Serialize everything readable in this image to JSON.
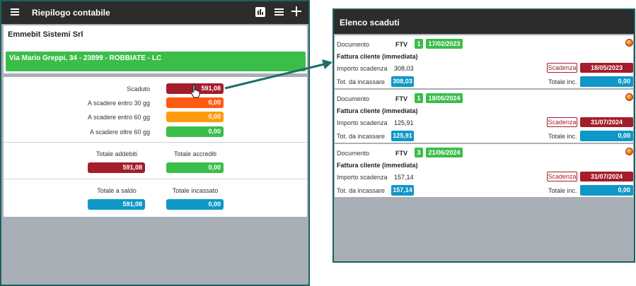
{
  "app": {
    "title": "Riepilogo contabile",
    "company_name": "Emmebit Sistemi Srl",
    "address": "Via Mario Greppi, 34 - 23899 - ROBBIATE - LC"
  },
  "summary": {
    "rows": [
      {
        "label": "Scaduto",
        "value": "591,08",
        "color": "#a51d2a"
      },
      {
        "label": "A scadere entro 30 gg",
        "value": "0,00",
        "color": "#ff5a12"
      },
      {
        "label": "A scadere entro 60 gg",
        "value": "0,00",
        "color": "#ff9a0f"
      },
      {
        "label": "A scadere oltre 60 gg",
        "value": "0,00",
        "color": "#3bbd4a"
      }
    ],
    "totale_addebiti_label": "Totale addebiti",
    "totale_addebiti_value": "591,08",
    "totale_accrediti_label": "Totale accrediti",
    "totale_accrediti_value": "0,00",
    "totale_saldo_label": "Totale a saldo",
    "totale_saldo_value": "591,08",
    "totale_incassato_label": "Totale incassato",
    "totale_incassato_value": "0,00"
  },
  "overdue_list": {
    "title": "Elenco scaduti",
    "labels": {
      "documento": "Documento",
      "importo": "Importo scadenza",
      "tot_incassare": "Tot. da incassare",
      "scadenza": "Scadenza",
      "totale_inc": "Totale inc."
    },
    "entries": [
      {
        "doc_type": "FTV",
        "number": "1",
        "date": "17/02/2023",
        "description": "Fattura cliente (immediata)",
        "amount": "308,03",
        "due_date": "18/05/2023",
        "to_collect": "308,03",
        "total_collected": "0,00"
      },
      {
        "doc_type": "FTV",
        "number": "1",
        "date": "18/06/2024",
        "description": "Fattura cliente (immediata)",
        "amount": "125,91",
        "due_date": "31/07/2024",
        "to_collect": "125,91",
        "total_collected": "0,00"
      },
      {
        "doc_type": "FTV",
        "number": "3",
        "date": "21/06/2024",
        "description": "Fattura cliente (immediata)",
        "amount": "157,14",
        "due_date": "31/07/2024",
        "to_collect": "157,14",
        "total_collected": "0,00"
      }
    ]
  },
  "colors": {
    "header": "#2c2c2c",
    "accent_green": "#3bbd4a",
    "danger_red": "#a51d2a",
    "info_blue": "#0f97c7",
    "panel_border": "#1f5f5f",
    "background_gray": "#a9afb6"
  },
  "icons": [
    "menu-icon",
    "bar-chart-icon",
    "list-icon",
    "plus-icon",
    "hand-pointer-icon",
    "status-dot-icon"
  ]
}
